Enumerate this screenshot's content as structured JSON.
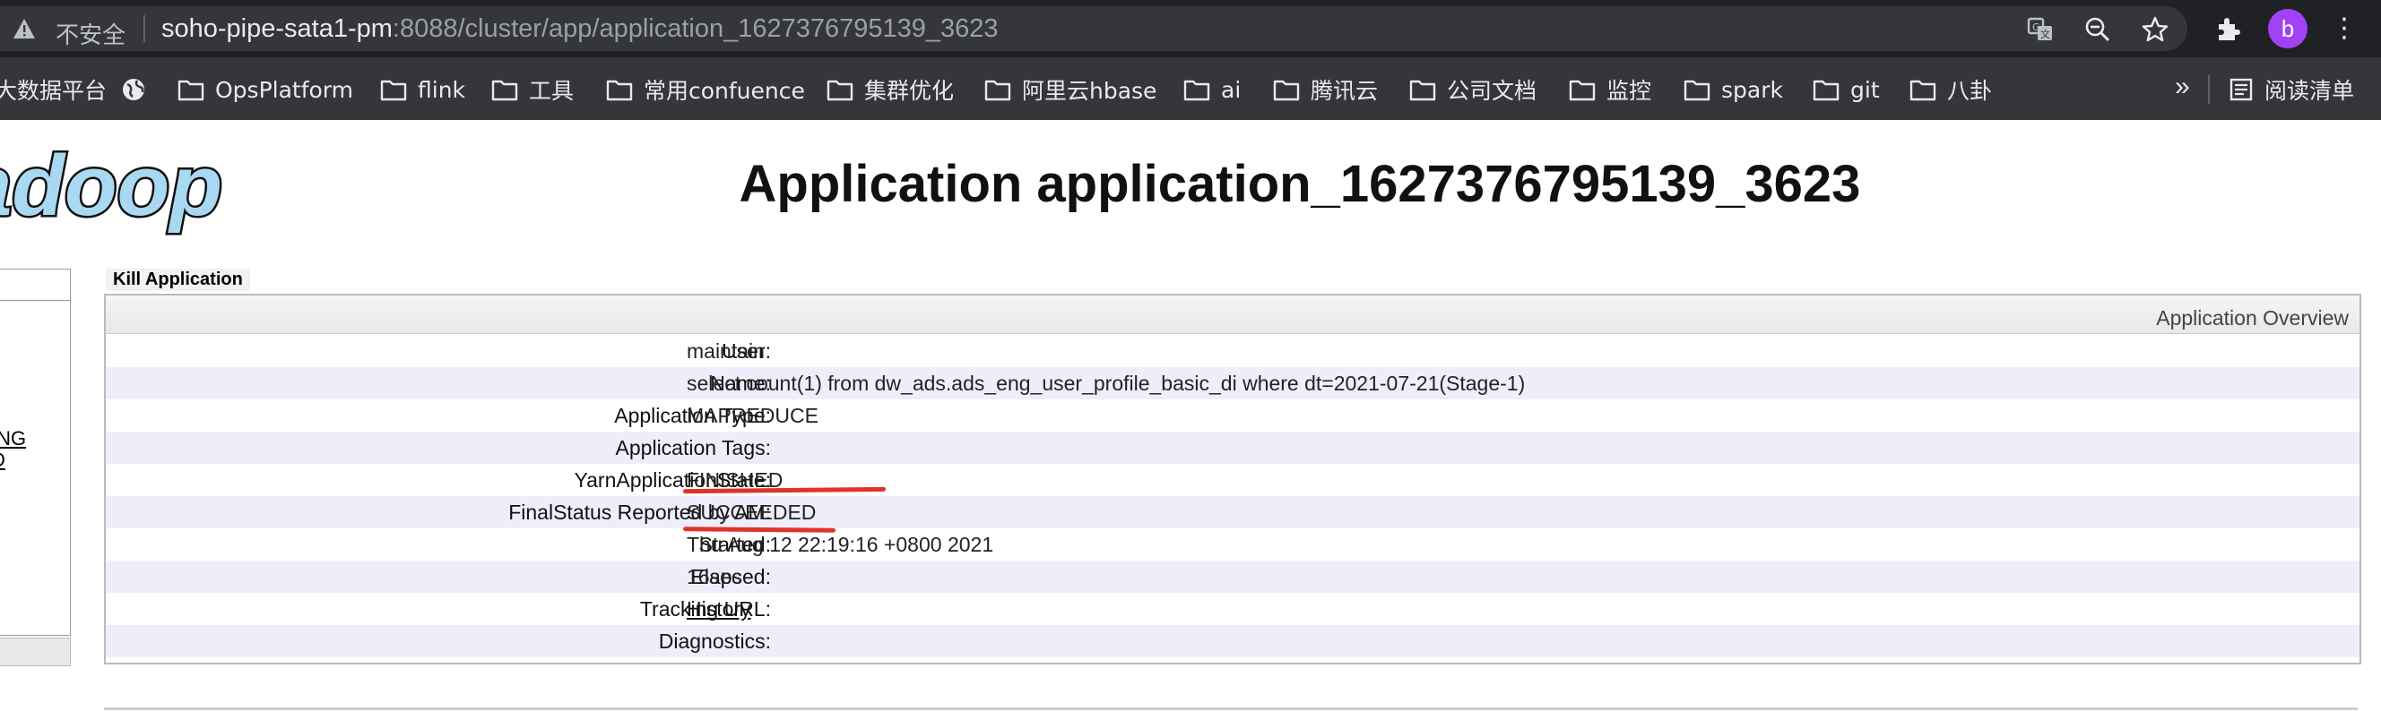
{
  "browser": {
    "security_text": "不安全",
    "url_host": "soho-pipe-sata1-pm",
    "url_rest": ":8088/cluster/app/application_1627376795139_3623",
    "profile_initial": "b",
    "reading_list": "阅读清单",
    "more_bookmarks": "»",
    "bookmarks": [
      {
        "label": "大数据平台",
        "icon": "none"
      },
      {
        "label": "",
        "icon": "globe-icon"
      },
      {
        "label": "OpsPlatform",
        "icon": "folder-icon"
      },
      {
        "label": "flink",
        "icon": "folder-icon"
      },
      {
        "label": "工具",
        "icon": "folder-icon"
      },
      {
        "label": "常用confuence",
        "icon": "folder-icon"
      },
      {
        "label": "集群优化",
        "icon": "folder-icon"
      },
      {
        "label": "阿里云hbase",
        "icon": "folder-icon"
      },
      {
        "label": "ai",
        "icon": "folder-icon"
      },
      {
        "label": "腾讯云",
        "icon": "folder-icon"
      },
      {
        "label": "公司文档",
        "icon": "folder-icon"
      },
      {
        "label": "监控",
        "icon": "folder-icon"
      },
      {
        "label": "spark",
        "icon": "folder-icon"
      },
      {
        "label": "git",
        "icon": "folder-icon"
      },
      {
        "label": "八卦",
        "icon": "folder-icon"
      }
    ]
  },
  "page": {
    "logo_text": "adoop",
    "title": "Application application_1627376795139_3623",
    "kill_label": "Kill Application",
    "left_nav": [
      "ING",
      "D"
    ],
    "overview_title": "Application Overview",
    "rows": [
      {
        "key": "User:",
        "value": "maintain",
        "link": false
      },
      {
        "key": "Name:",
        "value": "select count(1) from dw_ads.ads_eng_user_profile_basic_di where dt=2021-07-21(Stage-1)",
        "link": false
      },
      {
        "key": "Application Type:",
        "value": "MAPREDUCE",
        "link": false
      },
      {
        "key": "Application Tags:",
        "value": "",
        "link": false
      },
      {
        "key": "YarnApplicationState:",
        "value": "FINISHED",
        "link": false
      },
      {
        "key": "FinalStatus Reported by AM:",
        "value": "SUCCEEDED",
        "link": false
      },
      {
        "key": "Started:",
        "value": "Thu Aug 12 22:19:16 +0800 2021",
        "link": false
      },
      {
        "key": "Elapsed:",
        "value": "16sec",
        "link": false
      },
      {
        "key": "Tracking URL:",
        "value": "History",
        "link": true
      },
      {
        "key": "Diagnostics:",
        "value": "",
        "link": false
      }
    ]
  },
  "colors": {
    "annotation": "#e0322b",
    "row_alt": "#eeeefb",
    "chrome_dark": "#202124",
    "chrome_toolbar": "#35363a"
  }
}
